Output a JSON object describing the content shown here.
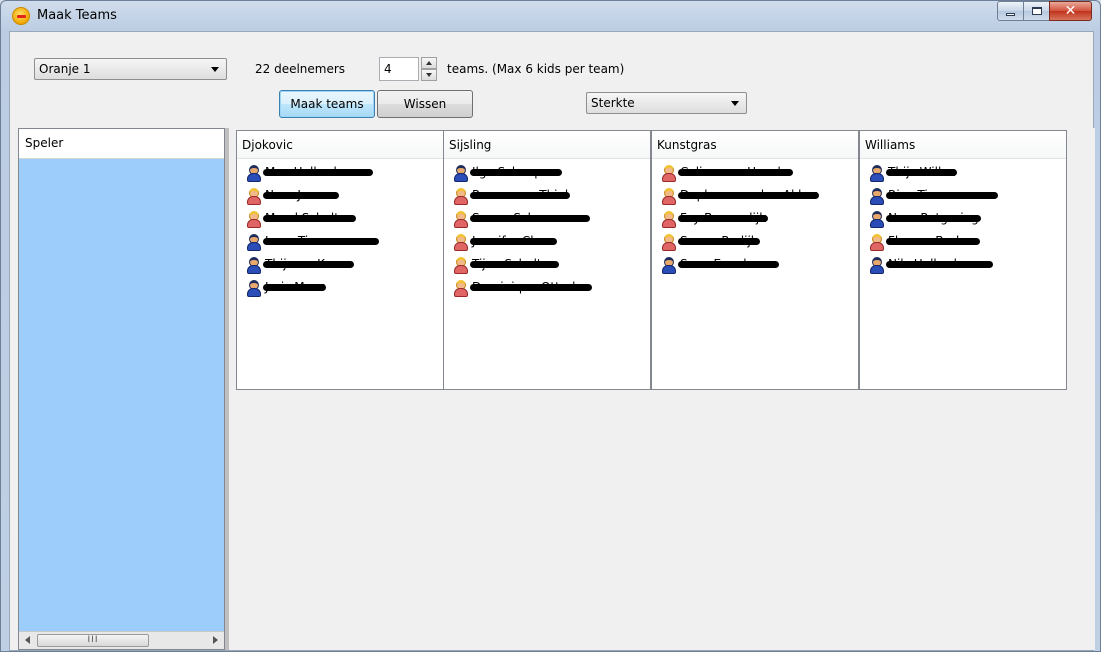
{
  "window": {
    "title": "Maak Teams",
    "close_glyph": "✕"
  },
  "toolbar": {
    "team_select": "Oranje 1",
    "participants_label": "22 deelnemers",
    "team_count": "4",
    "teams_suffix": "teams. (Max 6 kids per team)",
    "make_button": "Maak teams",
    "clear_button": "Wissen",
    "sort_select": "Sterkte"
  },
  "left_panel": {
    "header": "Speler",
    "scroll_thumb_glyph": "III"
  },
  "teams": [
    {
      "name": "Djokovic",
      "players": [
        {
          "name": "Max Halkeshoven",
          "gender": "boy"
        },
        {
          "name": "Nora Jansen",
          "gender": "girl"
        },
        {
          "name": "Maud Scholten",
          "gender": "girl"
        },
        {
          "name": "Luna Timmermans",
          "gender": "boy"
        },
        {
          "name": "Thijmen Kroon",
          "gender": "boy"
        },
        {
          "name": "Joris Meer",
          "gender": "boy"
        }
      ]
    },
    {
      "name": "Sijsling",
      "players": [
        {
          "name": "Ilgo Scheepers",
          "gender": "boy"
        },
        {
          "name": "Renee van Thiel",
          "gender": "girl"
        },
        {
          "name": "Sanne Schoormans",
          "gender": "girl"
        },
        {
          "name": "Jennifer Claus",
          "gender": "girl"
        },
        {
          "name": "Tijne Scholten",
          "gender": "girl"
        },
        {
          "name": "Dominique Otterloo",
          "gender": "girl"
        }
      ]
    },
    {
      "name": "Kunstgras",
      "players": [
        {
          "name": "Celine van Hoecke",
          "gender": "girl"
        },
        {
          "name": "Daphne van den Akker",
          "gender": "girl"
        },
        {
          "name": "Fay Boomsdijk",
          "gender": "girl"
        },
        {
          "name": "Sanna Rodijk",
          "gender": "girl"
        },
        {
          "name": "Sven Evenboom",
          "gender": "boy"
        }
      ]
    },
    {
      "name": "Williams",
      "players": [
        {
          "name": "Thijs Willox",
          "gender": "boy"
        },
        {
          "name": "Rico Timmermans",
          "gender": "boy"
        },
        {
          "name": "Noor Rotgering",
          "gender": "boy"
        },
        {
          "name": "Flo van Bruken",
          "gender": "girl"
        },
        {
          "name": "Nils Halkeshoven",
          "gender": "boy"
        }
      ]
    }
  ]
}
